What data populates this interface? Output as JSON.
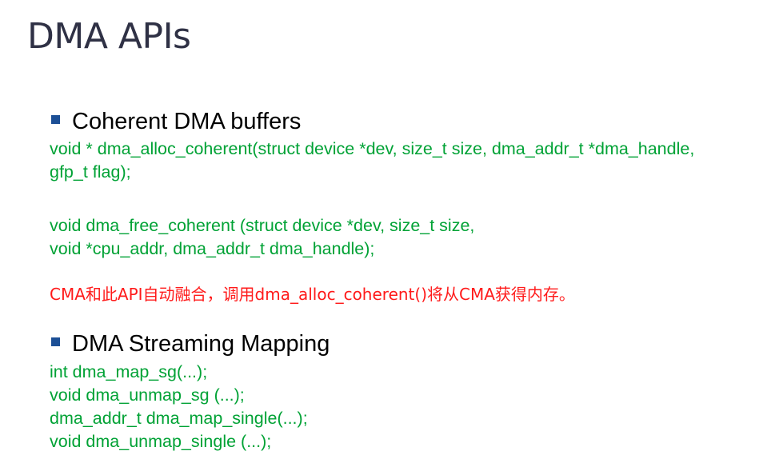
{
  "slide": {
    "title": "DMA APIs",
    "sections": [
      {
        "heading": "Coherent  DMA buffers",
        "code_blocks": [
          {
            "lines": [
              "void * dma_alloc_coherent(struct device *dev,  size_t size,  dma_addr_t *dma_handle,",
              "gfp_t flag);"
            ]
          },
          {
            "lines": [
              "void dma_free_coherent (struct device *dev,  size_t size,",
              "void *cpu_addr, dma_addr_t dma_handle);"
            ]
          }
        ],
        "note": "CMA和此API自动融合，调用dma_alloc_coherent()将从CMA获得内存。"
      },
      {
        "heading": "DMA Streaming  Mapping",
        "code_blocks": [
          {
            "lines": [
              "int dma_map_sg(...);",
              "void dma_unmap_sg (...);",
              "dma_addr_t dma_map_single(...);",
              "void dma_unmap_single (...);"
            ]
          }
        ]
      }
    ],
    "colors": {
      "title": "#2f3145",
      "bullet_marker": "#1c4f96",
      "code": "#00a235",
      "note": "#ff1a1a",
      "heading": "#000000"
    }
  }
}
